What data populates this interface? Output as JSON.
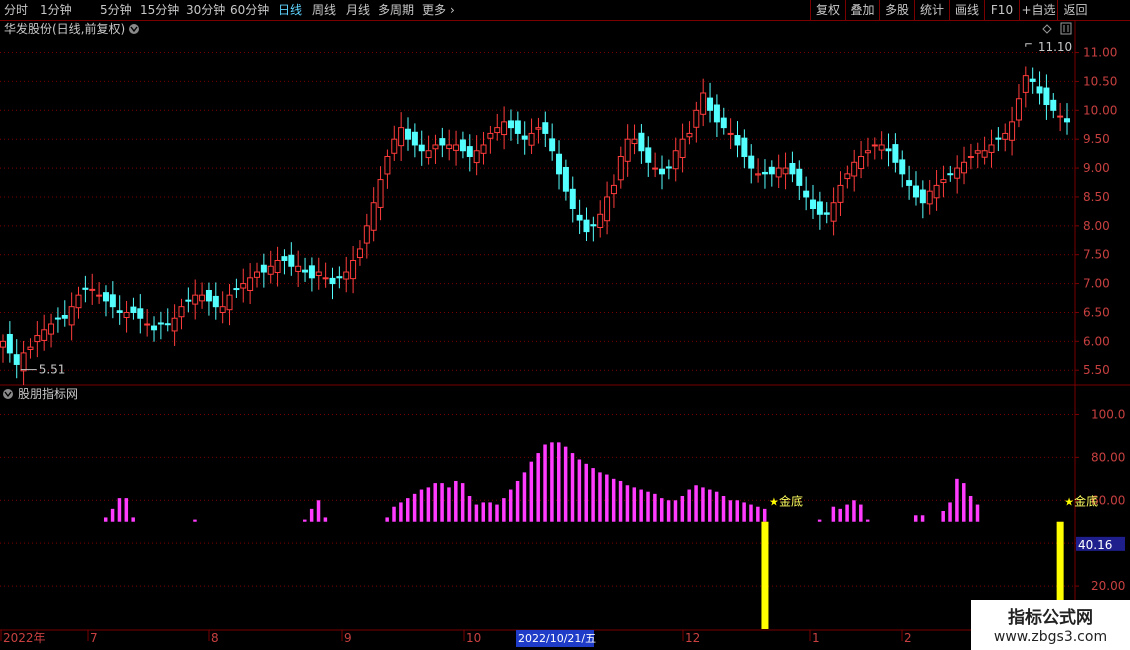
{
  "toolbar": {
    "periods": [
      "分时",
      "1分钟",
      "5分钟",
      "15分钟",
      "30分钟",
      "60分钟",
      "日线",
      "周线",
      "月线",
      "多周期",
      "更多"
    ],
    "more_icon": "chevron-right-icon",
    "active_period": "日线",
    "right_buttons": [
      "复权",
      "叠加",
      "多股",
      "统计",
      "画线",
      "F10",
      "+自选",
      "返回"
    ]
  },
  "main_panel": {
    "title": "华发股份(日线,前复权)",
    "collapse_icon": "chevron-down-icon",
    "settings_icon": "diamond-icon",
    "panel_icon": "pause-icon",
    "price_axis_labels": [
      "11.00",
      "10.50",
      "10.00",
      "9.50",
      "9.00",
      "8.50",
      "8.00",
      "7.50",
      "7.00",
      "6.50",
      "6.00",
      "5.50"
    ],
    "high_marker": "11.10",
    "low_marker": "5.51"
  },
  "indicator_panel": {
    "title": "股朋指标网",
    "collapse_icon": "chevron-down-icon",
    "axis_labels": [
      "100.0",
      "80.00",
      "60.00",
      "40.00",
      "20.00"
    ],
    "current_value": "40.16",
    "signal_label": "金底",
    "signal_icon": "star-icon"
  },
  "date_axis": {
    "labels": [
      "2022年",
      "7",
      "8",
      "9",
      "10",
      "12",
      "1",
      "2"
    ],
    "cursor_date": "2022/10/21/五"
  },
  "watermark": {
    "line1": "指标公式网",
    "line2": "www.zbgs3.com"
  },
  "colors": {
    "up": "#ff3c3c",
    "down": "#54ffff",
    "indicator_bar": "#ff3cff",
    "signal_bar": "#ffff00",
    "grid": "#7a0000",
    "active_tab": "#5fd4ff",
    "cursor_bg": "#1e3cc8"
  },
  "chart_data": {
    "type": "candlestick",
    "close_series": [
      6.0,
      5.8,
      5.6,
      5.8,
      5.9,
      6.1,
      6.2,
      6.3,
      6.4,
      6.4,
      6.6,
      6.8,
      6.9,
      6.9,
      6.8,
      6.7,
      6.6,
      6.5,
      6.5,
      6.5,
      6.4,
      6.3,
      6.2,
      6.3,
      6.3,
      6.4,
      6.6,
      6.7,
      6.8,
      6.8,
      6.7,
      6.6,
      6.6,
      6.8,
      6.9,
      7.0,
      7.1,
      7.2,
      7.2,
      7.3,
      7.4,
      7.4,
      7.3,
      7.3,
      7.2,
      7.1,
      7.2,
      7.1,
      7.0,
      7.1,
      7.2,
      7.4,
      7.6,
      8.0,
      8.4,
      8.8,
      9.2,
      9.5,
      9.7,
      9.5,
      9.4,
      9.3,
      9.3,
      9.4,
      9.4,
      9.4,
      9.4,
      9.3,
      9.2,
      9.3,
      9.4,
      9.6,
      9.7,
      9.8,
      9.7,
      9.6,
      9.5,
      9.6,
      9.7,
      9.6,
      9.3,
      8.9,
      8.6,
      8.3,
      8.1,
      7.9,
      8.0,
      8.2,
      8.5,
      8.7,
      9.2,
      9.5,
      9.5,
      9.3,
      9.1,
      9.0,
      8.9,
      9.0,
      9.3,
      9.5,
      9.6,
      10.0,
      10.3,
      10.0,
      9.8,
      9.7,
      9.6,
      9.4,
      9.2,
      9.0,
      8.9,
      8.9,
      8.9,
      9.0,
      9.0,
      8.9,
      8.7,
      8.5,
      8.3,
      8.2,
      8.2,
      8.4,
      8.7,
      8.9,
      9.1,
      9.2,
      9.3,
      9.4,
      9.4,
      9.3,
      9.1,
      8.9,
      8.7,
      8.5,
      8.4,
      8.6,
      8.7,
      8.8,
      8.9,
      9.0,
      9.1,
      9.2,
      9.3,
      9.3,
      9.4,
      9.5,
      9.6,
      9.8,
      10.2,
      10.6,
      10.5,
      10.3,
      10.1,
      10.0,
      9.9,
      9.8
    ],
    "price_range": [
      5.4,
      11.2
    ],
    "indicator_series": [
      0,
      0,
      0,
      0,
      0,
      0,
      0,
      0,
      0,
      0,
      0,
      0,
      0,
      0,
      0,
      52,
      56,
      61,
      61,
      52,
      0,
      0,
      0,
      0,
      0,
      0,
      0,
      0,
      51,
      0,
      0,
      0,
      0,
      0,
      0,
      0,
      0,
      0,
      0,
      0,
      0,
      0,
      0,
      0,
      51,
      56,
      60,
      52,
      0,
      0,
      0,
      0,
      0,
      0,
      0,
      0,
      52,
      57,
      59,
      61,
      63,
      65,
      66,
      68,
      68,
      66,
      69,
      68,
      62,
      58,
      59,
      59,
      58,
      61,
      65,
      69,
      73,
      78,
      82,
      86,
      87,
      87,
      85,
      82,
      79,
      77,
      75,
      73,
      72,
      70,
      69,
      67,
      66,
      65,
      64,
      63,
      61,
      60,
      60,
      62,
      65,
      67,
      66,
      65,
      64,
      62,
      60,
      60,
      59,
      58,
      57,
      56,
      0,
      0,
      0,
      0,
      0,
      0,
      0,
      51,
      0,
      57,
      56,
      58,
      60,
      58,
      51,
      0,
      0,
      0,
      0,
      0,
      0,
      53,
      53,
      0,
      0,
      55,
      59,
      70,
      68,
      62,
      58
    ],
    "indicator_range": [
      0,
      110
    ],
    "signal_indices": [
      111,
      154,
      173
    ]
  }
}
